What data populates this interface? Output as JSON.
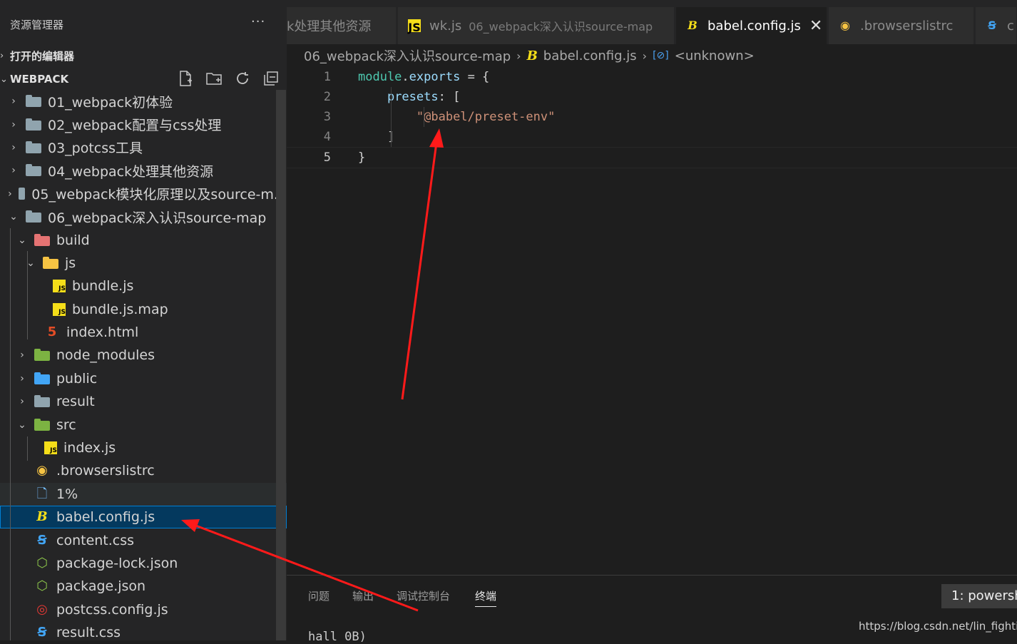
{
  "sidebar": {
    "title": "资源管理器",
    "more": "···",
    "open_editors": "打开的编辑器",
    "workspace": "WEBPACK",
    "tree": [
      {
        "label": "01_webpack初体验",
        "type": "folder"
      },
      {
        "label": "02_webpack配置与css处理",
        "type": "folder"
      },
      {
        "label": "03_potcss工具",
        "type": "folder"
      },
      {
        "label": "04_webpack处理其他资源",
        "type": "folder"
      },
      {
        "label": "05_webpack模块化原理以及source-m...",
        "type": "folder"
      },
      {
        "label": "06_webpack深入认识source-map",
        "type": "folder-open"
      },
      {
        "label": "build",
        "type": "folder-open"
      },
      {
        "label": "js",
        "type": "folder-open"
      },
      {
        "label": "bundle.js",
        "type": "js"
      },
      {
        "label": "bundle.js.map",
        "type": "js"
      },
      {
        "label": "index.html",
        "type": "html"
      },
      {
        "label": "node_modules",
        "type": "folder"
      },
      {
        "label": "public",
        "type": "folder"
      },
      {
        "label": "result",
        "type": "folder"
      },
      {
        "label": "src",
        "type": "folder-open"
      },
      {
        "label": "index.js",
        "type": "js"
      },
      {
        "label": ".browserslistrc",
        "type": "browserslist"
      },
      {
        "label": "1%",
        "type": "file"
      },
      {
        "label": "babel.config.js",
        "type": "babel"
      },
      {
        "label": "content.css",
        "type": "css"
      },
      {
        "label": "package-lock.json",
        "type": "npm"
      },
      {
        "label": "package.json",
        "type": "npm"
      },
      {
        "label": "postcss.config.js",
        "type": "postcss"
      },
      {
        "label": "result.css",
        "type": "css"
      }
    ]
  },
  "tabs": [
    {
      "label": "k处理其他资源",
      "desc": ""
    },
    {
      "label": "wk.js",
      "desc": "06_webpack深入认识source-map"
    },
    {
      "label": "babel.config.js",
      "desc": ""
    },
    {
      "label": ".browserslistrc",
      "desc": ""
    },
    {
      "label": "c",
      "desc": ""
    }
  ],
  "breadcrumb": {
    "folder": "06_webpack深入认识source-map",
    "file": "babel.config.js",
    "symbol": "<unknown>"
  },
  "editor": {
    "lines": [
      {
        "num": "1",
        "parts": [
          [
            "var",
            "module"
          ],
          [
            "punc",
            "."
          ],
          [
            "prop",
            "exports"
          ],
          [
            "punc",
            " = "
          ],
          [
            "punc",
            "{"
          ]
        ]
      },
      {
        "num": "2",
        "parts": [
          [
            "punc",
            "    "
          ],
          [
            "prop",
            "presets"
          ],
          [
            "punc",
            ": ["
          ]
        ]
      },
      {
        "num": "3",
        "parts": [
          [
            "punc",
            "        "
          ],
          [
            "str",
            "\"@babel/preset-env\""
          ]
        ]
      },
      {
        "num": "4",
        "parts": [
          [
            "punc",
            "    ]"
          ]
        ]
      },
      {
        "num": "5",
        "parts": [
          [
            "punc",
            "}"
          ]
        ]
      }
    ]
  },
  "panel": {
    "tabs": [
      "问题",
      "输出",
      "调试控制台",
      "终端"
    ],
    "terminal_select": "1: powersh",
    "terminal_text": "hall 0B)",
    "watermark": "https://blog.csdn.net/lin_fightin"
  },
  "colors": {
    "accent": "#007fd4",
    "annotation": "#ff1a1a"
  }
}
